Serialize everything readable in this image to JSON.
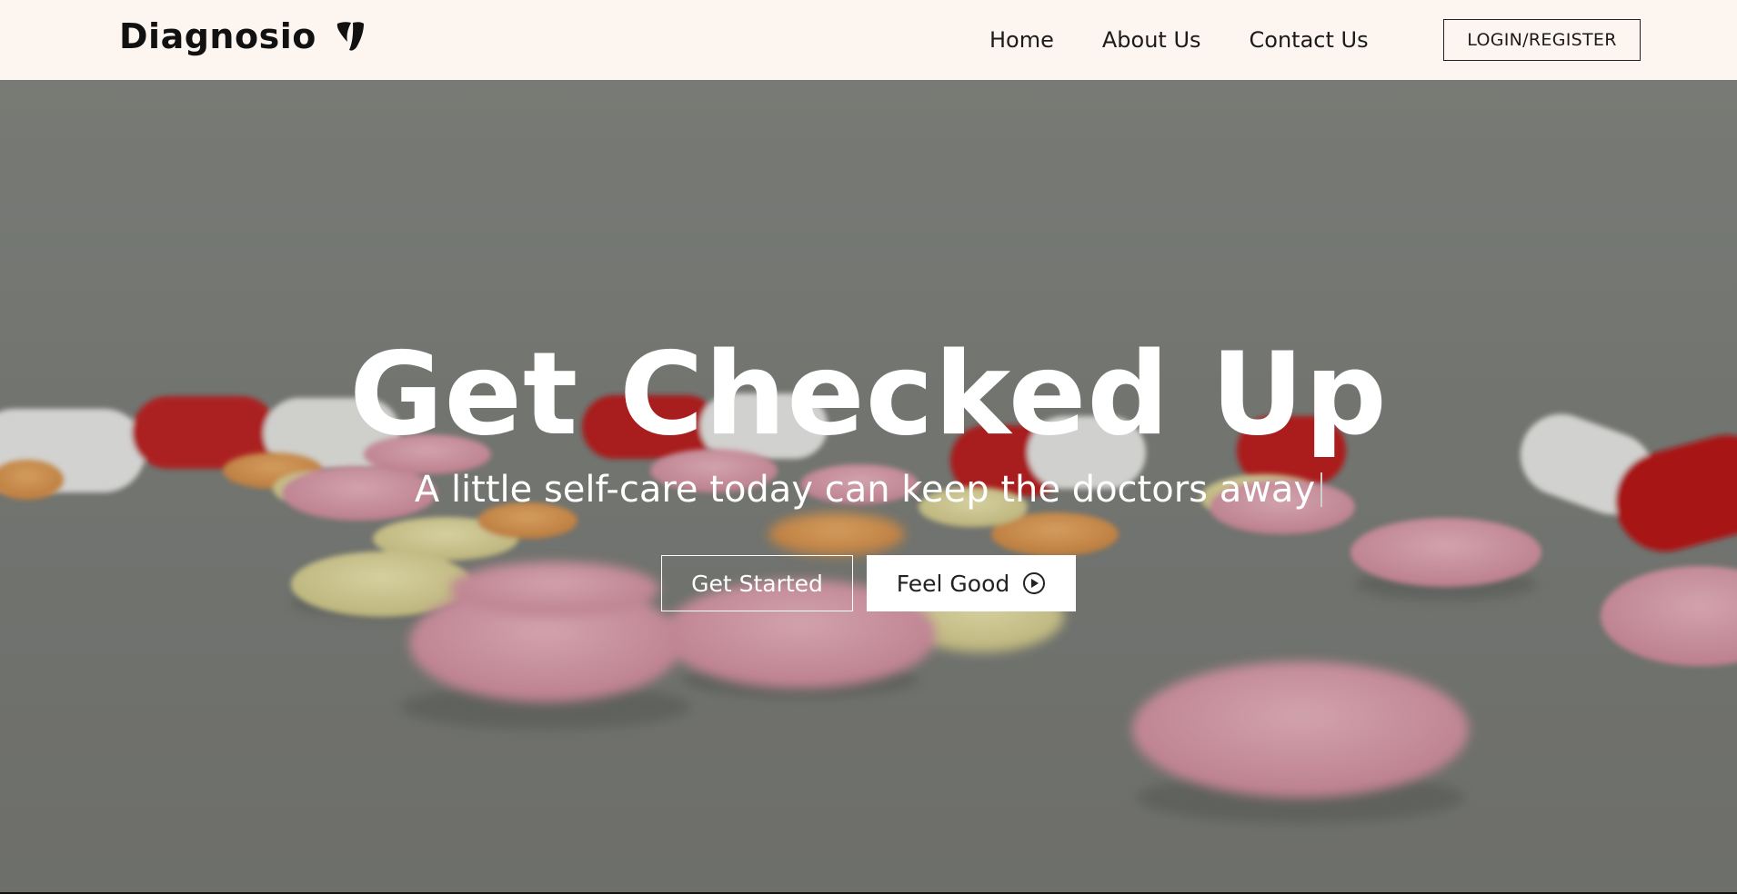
{
  "navbar": {
    "brand": "Diagnosio",
    "brand_icon": "typo3-logo-icon",
    "links": [
      "Home",
      "About Us",
      "Contact Us"
    ],
    "login_label": "LOGIN/REGISTER"
  },
  "hero": {
    "title": "Get Checked Up",
    "subtitle": "A little self-care today can keep the doctors away",
    "primary_button": "Get Started",
    "secondary_button": "Feel Good",
    "secondary_icon": "play-circle-icon",
    "background": "pills-on-table-photo"
  },
  "colors": {
    "navbar_bg": "#fdf5ef",
    "text_dark": "#1b1b1b",
    "hero_text": "#ffffff"
  }
}
